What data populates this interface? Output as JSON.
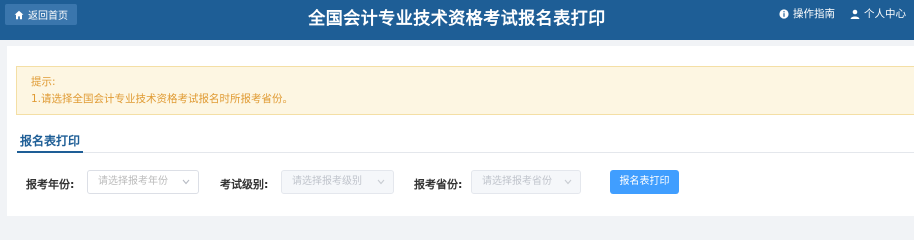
{
  "header": {
    "home_label": "返回首页",
    "title": "全国会计专业技术资格考试报名表打印",
    "guide_label": "操作指南",
    "user_center_label": "个人中心"
  },
  "notice": {
    "heading": "提示:",
    "line1": "1.请选择全国会计专业技术资格考试报名时所报考省份。"
  },
  "tabs": [
    {
      "label": "报名表打印",
      "active": true
    }
  ],
  "form": {
    "year_label": "报考年份:",
    "year_placeholder": "请选择报考年份",
    "level_label": "考试级别:",
    "level_placeholder": "请选择报考级别",
    "province_label": "报考省份:",
    "province_placeholder": "请选择报考省份",
    "print_button": "报名表打印"
  },
  "colors": {
    "header_bg": "#1e5e96",
    "notice_text": "#e09b34",
    "notice_bg": "#fdf6e2",
    "primary_button": "#409eff"
  },
  "icons": {
    "home": "home-icon",
    "guide": "info-icon",
    "user": "user-icon",
    "dropdown": "chevron-down-icon"
  }
}
